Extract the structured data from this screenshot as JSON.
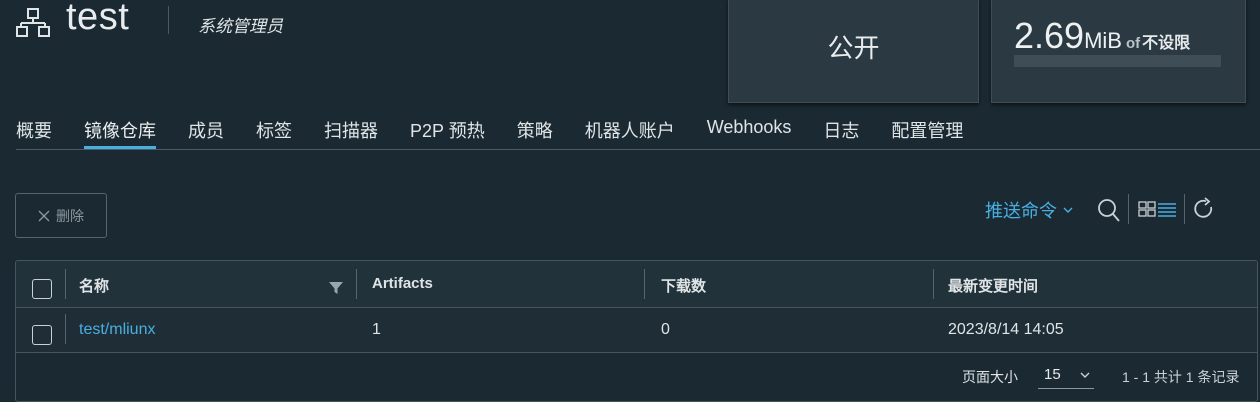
{
  "project": {
    "name": "test",
    "role": "系统管理员"
  },
  "access_card": {
    "label": "公开"
  },
  "quota_card": {
    "value": "2.69",
    "unit": "MiB",
    "of": "of",
    "limit": "不设限",
    "usage_fraction": 0
  },
  "tabs": [
    {
      "label": "概要",
      "active": false
    },
    {
      "label": "镜像仓库",
      "active": true
    },
    {
      "label": "成员",
      "active": false
    },
    {
      "label": "标签",
      "active": false
    },
    {
      "label": "扫描器",
      "active": false
    },
    {
      "label": "P2P 预热",
      "active": false
    },
    {
      "label": "策略",
      "active": false
    },
    {
      "label": "机器人账户",
      "active": false
    },
    {
      "label": "Webhooks",
      "active": false
    },
    {
      "label": "日志",
      "active": false
    },
    {
      "label": "配置管理",
      "active": false
    }
  ],
  "toolbar": {
    "delete_label": "删除",
    "push_command_label": "推送命令"
  },
  "table": {
    "columns": [
      "名称",
      "Artifacts",
      "下载数",
      "最新变更时间"
    ],
    "rows": [
      {
        "name": "test/mliunx",
        "artifacts": "1",
        "downloads": "0",
        "updated": "2023/8/14 14:05"
      }
    ]
  },
  "pagination": {
    "page_size_label": "页面大小",
    "page_size": "15",
    "info": "1 - 1 共计 1 条记录"
  },
  "colors": {
    "accent": "#49aee2",
    "background": "#1b2a32",
    "card": "#2b3a42"
  },
  "icons": [
    "project-icon",
    "close-icon",
    "chevron-down-icon",
    "search-icon",
    "grid-view-icon",
    "list-view-icon",
    "refresh-icon",
    "filter-icon"
  ]
}
